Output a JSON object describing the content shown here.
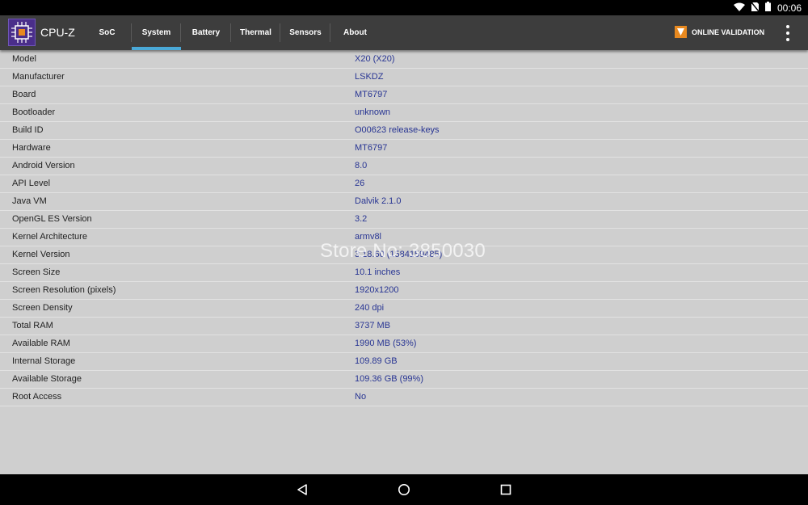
{
  "status_bar": {
    "time": "00:06",
    "wifi_icon": "wifi-icon",
    "sim_icon": "no-sim-icon",
    "battery_icon": "battery-icon"
  },
  "app": {
    "title": "CPU-Z",
    "logo_icon": "cpu-chip-icon"
  },
  "tabs": [
    {
      "label": "SoC",
      "active": false
    },
    {
      "label": "System",
      "active": true
    },
    {
      "label": "Battery",
      "active": false
    },
    {
      "label": "Thermal",
      "active": false
    },
    {
      "label": "Sensors",
      "active": false
    },
    {
      "label": "About",
      "active": false
    }
  ],
  "validation": {
    "label": "ONLINE VALIDATION",
    "icon": "validation-icon",
    "color": "#E8891F"
  },
  "overflow_menu_icon": "more-vert-icon",
  "accent_color": "#4AA9D8",
  "value_color": "#283593",
  "rows": [
    {
      "label": "Model",
      "value": "X20 (X20)"
    },
    {
      "label": "Manufacturer",
      "value": "LSKDZ"
    },
    {
      "label": "Board",
      "value": "MT6797"
    },
    {
      "label": "Bootloader",
      "value": "unknown"
    },
    {
      "label": "Build ID",
      "value": "O00623 release-keys"
    },
    {
      "label": "Hardware",
      "value": "MT6797"
    },
    {
      "label": "Android Version",
      "value": "8.0"
    },
    {
      "label": "API Level",
      "value": "26"
    },
    {
      "label": "Java VM",
      "value": "Dalvik 2.1.0"
    },
    {
      "label": "OpenGL ES Version",
      "value": "3.2"
    },
    {
      "label": "Kernel Architecture",
      "value": "armv8l"
    },
    {
      "label": "Kernel Version",
      "value": "3.18.60 (1584159485)"
    },
    {
      "label": "Screen Size",
      "value": "10.1 inches"
    },
    {
      "label": "Screen Resolution (pixels)",
      "value": "1920x1200"
    },
    {
      "label": "Screen Density",
      "value": "240 dpi"
    },
    {
      "label": "Total RAM",
      "value": "3737 MB"
    },
    {
      "label": "Available RAM",
      "value": "1990 MB  (53%)"
    },
    {
      "label": "Internal Storage",
      "value": "109.89 GB"
    },
    {
      "label": "Available Storage",
      "value": "109.36 GB (99%)"
    },
    {
      "label": "Root Access",
      "value": "No"
    }
  ],
  "watermark": "Store No: 3850030",
  "nav_bar": {
    "back_icon": "back-icon",
    "home_icon": "home-icon",
    "recents_icon": "recents-icon"
  }
}
